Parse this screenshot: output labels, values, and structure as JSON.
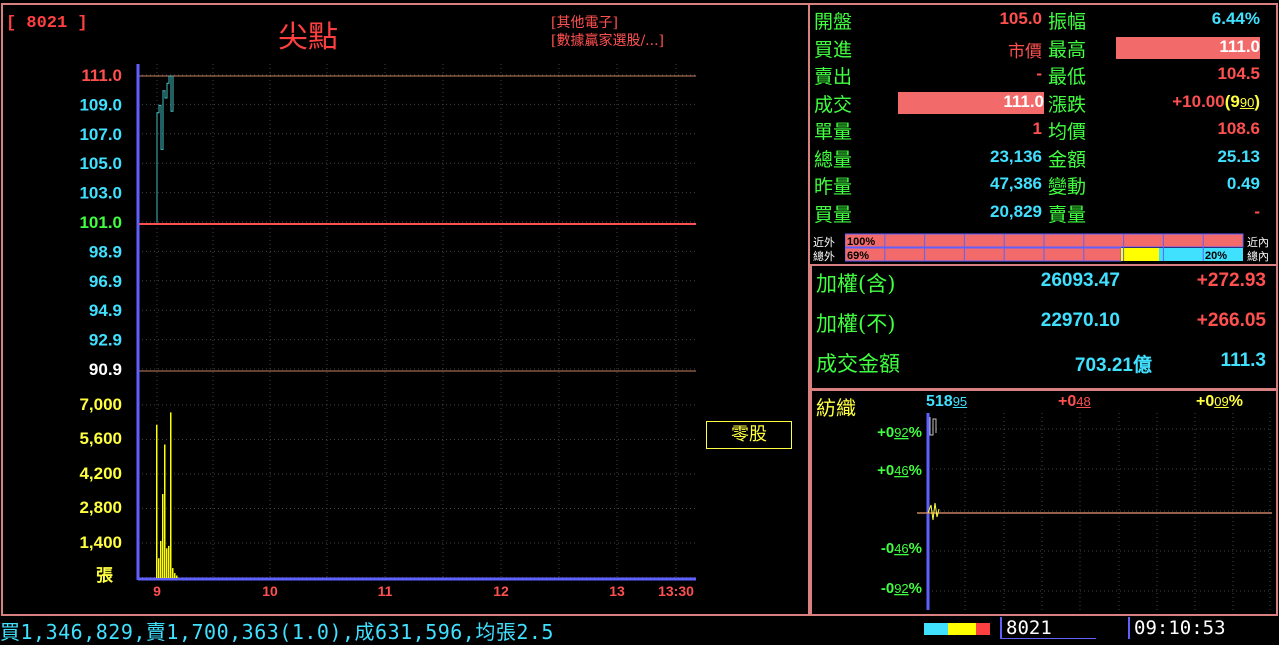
{
  "header": {
    "code": "[ 8021 ]",
    "chart_title": "尖點",
    "tag1": "[其他電子]",
    "tag2": "[數據贏家選股/...]"
  },
  "price_axis": [
    "111.0",
    "109.0",
    "107.0",
    "105.0",
    "103.0",
    "101.0",
    "98.9",
    "96.9",
    "94.9",
    "92.9",
    "90.9"
  ],
  "volume_axis": [
    "7,000",
    "5,600",
    "4,200",
    "2,800",
    "1,400",
    "張"
  ],
  "time_axis": [
    "9",
    "10",
    "11",
    "12",
    "13",
    "13:30"
  ],
  "odd_lot_button": "零股",
  "quote": {
    "open_label": "開盤",
    "open": "105.0",
    "amp_label": "振幅",
    "amp": "6.44%",
    "bid_label": "買進",
    "bid": "市價",
    "high_label": "最高",
    "high": "111.0",
    "ask_label": "賣出",
    "ask": "-",
    "low_label": "最低",
    "low": "104.5",
    "trade_label": "成交",
    "trade": "111.0",
    "chg_label": "漲跌",
    "chg": "+10.00",
    "chg_pct": "9",
    "chg_pct_dec": "90",
    "unitvol_label": "單量",
    "unitvol": "1",
    "avg_label": "均價",
    "avg": "108.6",
    "totvol_label": "總量",
    "totvol": "23,136",
    "amount_label": "金額",
    "amount": "25.13",
    "yvol_label": "昨量",
    "yvol": "47,386",
    "change_label": "變動",
    "change": "0.49",
    "buyvol_label": "買量",
    "buyvol": "20,829",
    "sellvol_label": "賣量",
    "sellvol": "-"
  },
  "ratio_bars": {
    "near_out_label": "近外",
    "near_in_label": "近內",
    "near_pct": "100%",
    "total_out_label": "總外",
    "total_in_label": "總內",
    "total_out_pct": "69%",
    "total_in_pct": "20%"
  },
  "index": {
    "weighted_incl_label": "加權(含)",
    "weighted_incl": "26093.47",
    "weighted_incl_chg": "+272.93",
    "weighted_excl_label": "加權(不)",
    "weighted_excl": "22970.10",
    "weighted_excl_chg": "+266.05",
    "turnover_label": "成交金額",
    "turnover": "703.21億",
    "turnover_extra": "111.3"
  },
  "sector": {
    "name": "紡織",
    "price_int": "518",
    "price_dec": "95",
    "chg_int": "+0",
    "chg_dec": "48",
    "pct_int": "+0",
    "pct_dec": "09",
    "pct_sign": "%",
    "axis": [
      {
        "int": "+0",
        "dec": "92"
      },
      {
        "int": "+0",
        "dec": "46"
      },
      {
        "int": "-0",
        "dec": "46"
      },
      {
        "int": "-0",
        "dec": "92"
      }
    ],
    "pct": "%"
  },
  "status_bar": {
    "ticker": "買1,346,829,賣1,700,363(1.0),成631,596,均張2.5",
    "code": "8021",
    "time": "09:10:53"
  },
  "colors": {
    "frame": "#d98080",
    "grid": "#3a3a3a",
    "axis_blue": "#6060ff",
    "price_line": "#40c0c0",
    "volume": "#ffff00",
    "ref_line": "#ff4040"
  }
}
